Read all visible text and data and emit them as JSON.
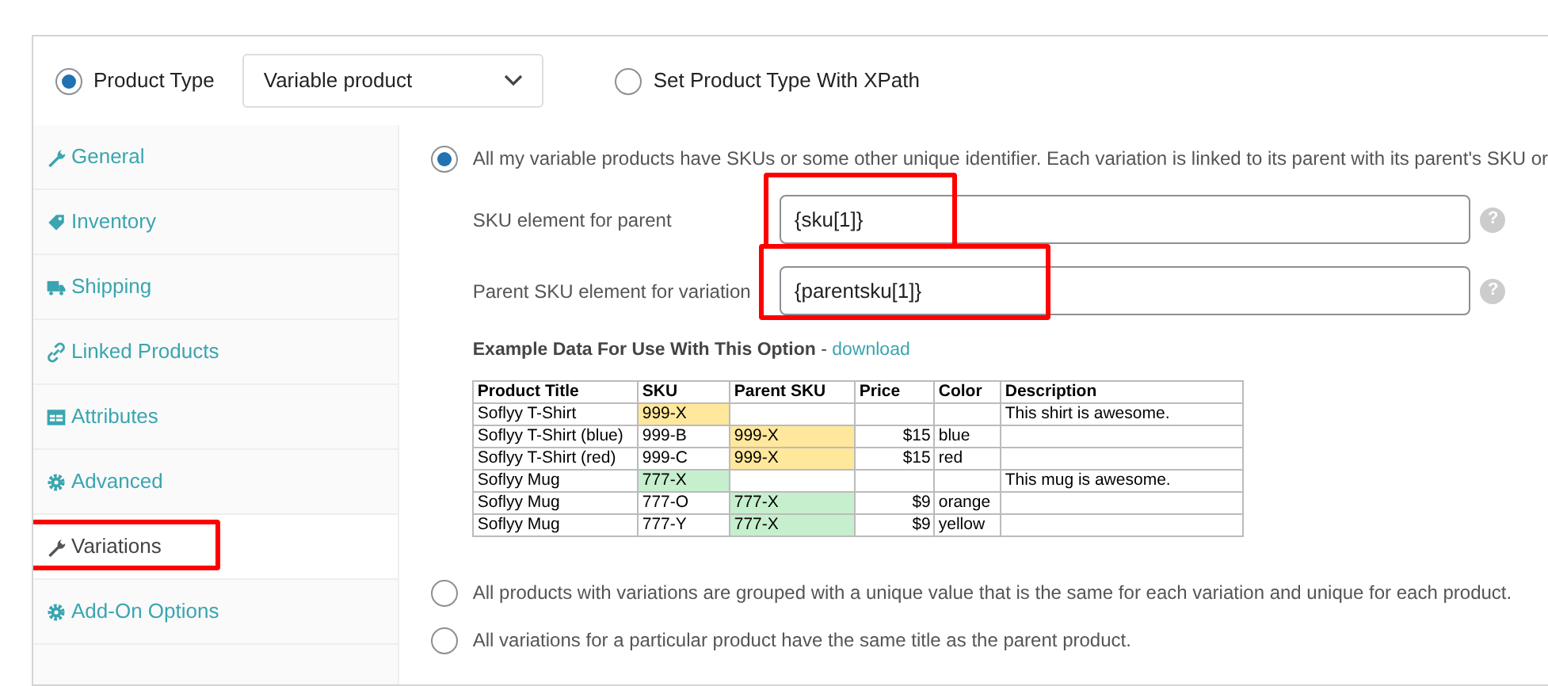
{
  "product_type": {
    "selected": true,
    "label": "Product Type",
    "dropdown_value": "Variable product"
  },
  "xpath_option": {
    "selected": false,
    "label": "Set Product Type With XPath"
  },
  "sidebar": {
    "items": [
      {
        "label": "General",
        "selected": false,
        "highlighted": false
      },
      {
        "label": "Inventory",
        "selected": false,
        "highlighted": false
      },
      {
        "label": "Shipping",
        "selected": false,
        "highlighted": false
      },
      {
        "label": "Linked Products",
        "selected": false,
        "highlighted": false
      },
      {
        "label": "Attributes",
        "selected": false,
        "highlighted": false
      },
      {
        "label": "Advanced",
        "selected": false,
        "highlighted": false
      },
      {
        "label": "Variations",
        "selected": true,
        "highlighted": true
      },
      {
        "label": "Add-On Options",
        "selected": false,
        "highlighted": false
      }
    ]
  },
  "options": [
    {
      "selected": true,
      "label": "All my variable products have SKUs or some other unique identifier. Each variation is linked to its parent with its parent's SKU or"
    },
    {
      "selected": false,
      "label": "All products with variations are grouped with a unique value that is the same for each variation and unique for each product."
    },
    {
      "selected": false,
      "label": "All variations for a particular product have the same title as the parent product."
    }
  ],
  "fields": [
    {
      "label": "SKU element for parent",
      "value": "{sku[1]}",
      "help": "?",
      "highlighted": true
    },
    {
      "label": "Parent SKU element for variation",
      "value": "{parentsku[1]}",
      "help": "?",
      "highlighted": true
    }
  ],
  "example": {
    "title": "Example Data For Use With This Option",
    "separator": " - ",
    "link": "download",
    "columns": [
      "Product Title",
      "SKU",
      "Parent SKU",
      "Price",
      "Color",
      "Description"
    ],
    "rows": [
      [
        {
          "text": "Soflyy T-Shirt"
        },
        {
          "text": "999-X",
          "color": "#ffe89c"
        },
        {},
        {},
        {},
        {
          "text": "This shirt is awesome."
        }
      ],
      [
        {
          "text": "Soflyy T-Shirt (blue)"
        },
        {
          "text": "999-B"
        },
        {
          "text": "999-X",
          "color": "#ffe89c"
        },
        {
          "text": "$15"
        },
        {
          "text": "blue"
        },
        {}
      ],
      [
        {
          "text": "Soflyy T-Shirt (red)"
        },
        {
          "text": "999-C"
        },
        {
          "text": "999-X",
          "color": "#ffe89c"
        },
        {
          "text": "$15"
        },
        {
          "text": "red"
        },
        {}
      ],
      [
        {
          "text": "Soflyy Mug"
        },
        {
          "text": "777-X",
          "color": "#c6efce"
        },
        {},
        {},
        {},
        {
          "text": "This mug is awesome."
        }
      ],
      [
        {
          "text": "Soflyy Mug"
        },
        {
          "text": "777-O"
        },
        {
          "text": "777-X",
          "color": "#c6efce"
        },
        {
          "text": "$9"
        },
        {
          "text": "orange"
        },
        {}
      ],
      [
        {
          "text": "Soflyy Mug"
        },
        {
          "text": "777-Y"
        },
        {
          "text": "777-X",
          "color": "#c6efce"
        },
        {
          "text": "$9"
        },
        {
          "text": "yellow"
        },
        {}
      ]
    ]
  }
}
